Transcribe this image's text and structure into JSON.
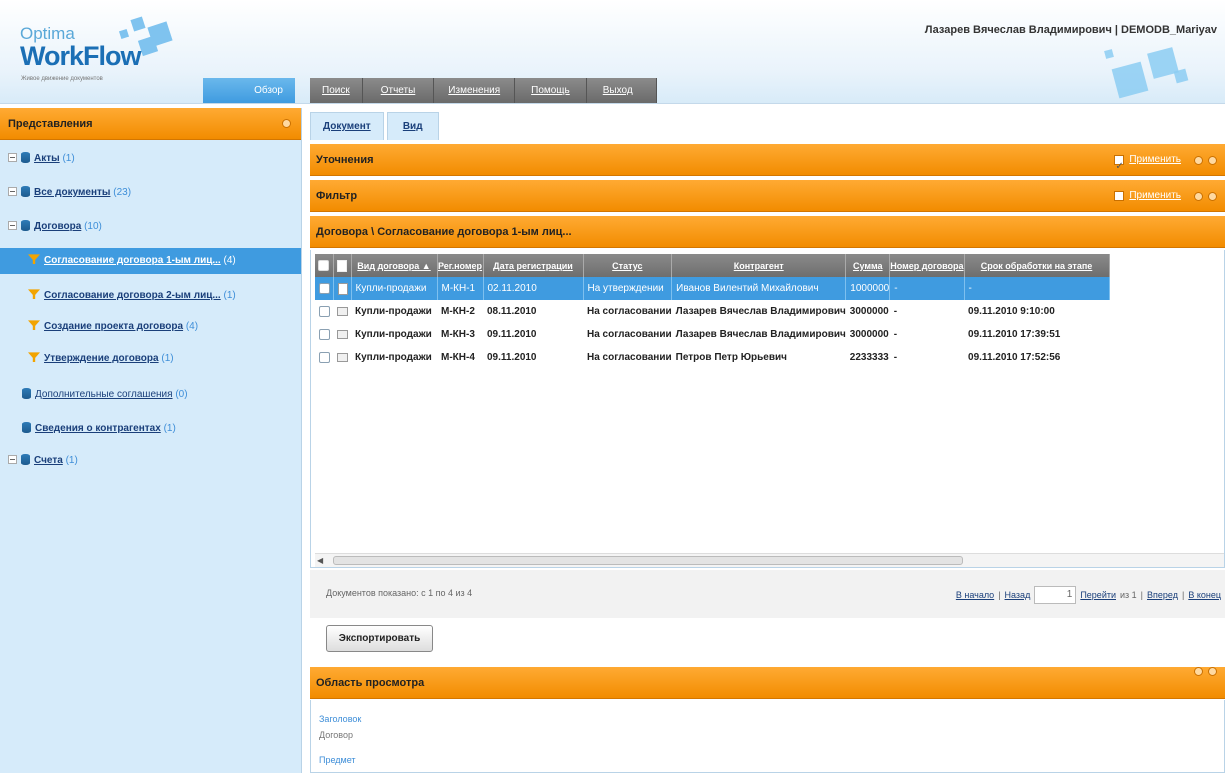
{
  "header": {
    "logo_top": "Optima",
    "logo_main": "WorkFlow",
    "logo_sub": "Живое движение документов",
    "user": "Лазарев Вячеслав Владимирович  |  DEMODB_Mariyav"
  },
  "topnav": {
    "tabs": [
      {
        "label": "Обзор",
        "active": true
      },
      {
        "label": "Поиск"
      },
      {
        "label": "Отчеты"
      },
      {
        "label": "Изменения"
      },
      {
        "label": "Помощь"
      },
      {
        "label": "Выход"
      }
    ]
  },
  "sidebar": {
    "title": "Представления",
    "items": [
      {
        "label": "Акты",
        "count": "(1)",
        "icon": "database-icon",
        "expand": true,
        "level": 0
      },
      {
        "label": "Все документы",
        "count": "(23)",
        "icon": "database-icon",
        "expand": true,
        "level": 0
      },
      {
        "label": "Договора",
        "count": "(10)",
        "icon": "database-icon",
        "expand": true,
        "level": 0
      },
      {
        "label": "Согласование договора 1-ым лиц...",
        "count": "(4)",
        "icon": "filter-icon",
        "level": 1,
        "selected": true
      },
      {
        "label": "Согласование договора 2-ым лиц...",
        "count": "(1)",
        "icon": "filter-icon",
        "level": 1
      },
      {
        "label": "Создание проекта договора",
        "count": "(4)",
        "icon": "filter-icon",
        "level": 1
      },
      {
        "label": "Утверждение договора",
        "count": "(1)",
        "icon": "filter-icon",
        "level": 1
      },
      {
        "label": "Дополнительные соглашения",
        "count": "(0)",
        "icon": "database-icon",
        "level": 0
      },
      {
        "label": "Сведения о контрагентах",
        "count": "(1)",
        "icon": "database-icon",
        "level": 0
      },
      {
        "label": "Счета",
        "count": "(1)",
        "icon": "database-icon",
        "expand": true,
        "level": 0
      }
    ]
  },
  "main": {
    "viewtabs": [
      "Документ",
      "Вид"
    ],
    "refine_bar": {
      "title": "Уточнения",
      "apply": "Применить",
      "checked": true
    },
    "filter_bar": {
      "title": "Фильтр",
      "apply": "Применить",
      "checked": false
    },
    "path_bar": "Договора \\ Согласование договора 1-ым лиц...",
    "table": {
      "columns": [
        "Вид договора ▲",
        "Рег.номер",
        "Дата регистрации",
        "Статус",
        "Контрагент",
        "Сумма",
        "Номер договора",
        "Срок обработки на этапе"
      ],
      "rows": [
        [
          "Купли-продажи",
          "М-КН-1",
          "02.11.2010",
          "На утверждении",
          "Иванов Вилентий Михайлович",
          "1000000",
          "-",
          "-"
        ],
        [
          "Купли-продажи",
          "М-КН-2",
          "08.11.2010",
          "На согласовании",
          "Лазарев Вячеслав Владимирович",
          "3000000",
          "-",
          "09.11.2010 9:10:00"
        ],
        [
          "Купли-продажи",
          "М-КН-3",
          "09.11.2010",
          "На согласовании",
          "Лазарев Вячеслав Владимирович",
          "3000000",
          "-",
          "09.11.2010 17:39:51"
        ],
        [
          "Купли-продажи",
          "М-КН-4",
          "09.11.2010",
          "На согласовании",
          "Петров Петр Юрьевич",
          "2233333",
          "-",
          "09.11.2010 17:52:56"
        ]
      ]
    },
    "pager": {
      "info": "Документов показано: с 1 по 4 из 4",
      "first": "В начало",
      "prev": "Назад",
      "page": "1",
      "goto": "Перейти",
      "of": "из 1",
      "next": "Вперед",
      "last": "В конец"
    },
    "export_label": "Экспортировать",
    "preview": {
      "title": "Область просмотра",
      "field1_label": "Заголовок",
      "field1_value": "Договор",
      "field2_label": "Предмет"
    }
  },
  "colors": {
    "accent_orange": "#f28c00",
    "accent_blue": "#3f9be0",
    "sidebar_bg": "#d6ebfa"
  }
}
